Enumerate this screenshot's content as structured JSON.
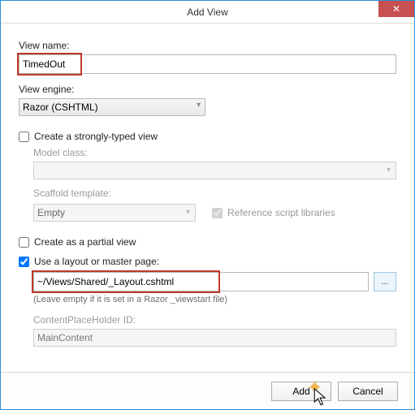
{
  "window": {
    "title": "Add View",
    "close_label": "✕"
  },
  "viewName": {
    "label": "View name:",
    "value": "TimedOut"
  },
  "viewEngine": {
    "label": "View engine:",
    "value": "Razor (CSHTML)"
  },
  "stronglyTyped": {
    "label": "Create a strongly-typed view",
    "checked": false
  },
  "modelClass": {
    "label": "Model class:",
    "value": ""
  },
  "scaffold": {
    "label": "Scaffold template:",
    "value": "Empty"
  },
  "referenceScripts": {
    "label": "Reference script libraries",
    "checked": true
  },
  "partialView": {
    "label": "Create as a partial view",
    "checked": false
  },
  "useLayout": {
    "label": "Use a layout or master page:",
    "checked": true,
    "value": "~/Views/Shared/_Layout.cshtml",
    "hint": "(Leave empty if it is set in a Razor _viewstart file)",
    "browse": "..."
  },
  "placeholder": {
    "label": "ContentPlaceHolder ID:",
    "value": "MainContent"
  },
  "buttons": {
    "add": "Add",
    "cancel": "Cancel"
  }
}
